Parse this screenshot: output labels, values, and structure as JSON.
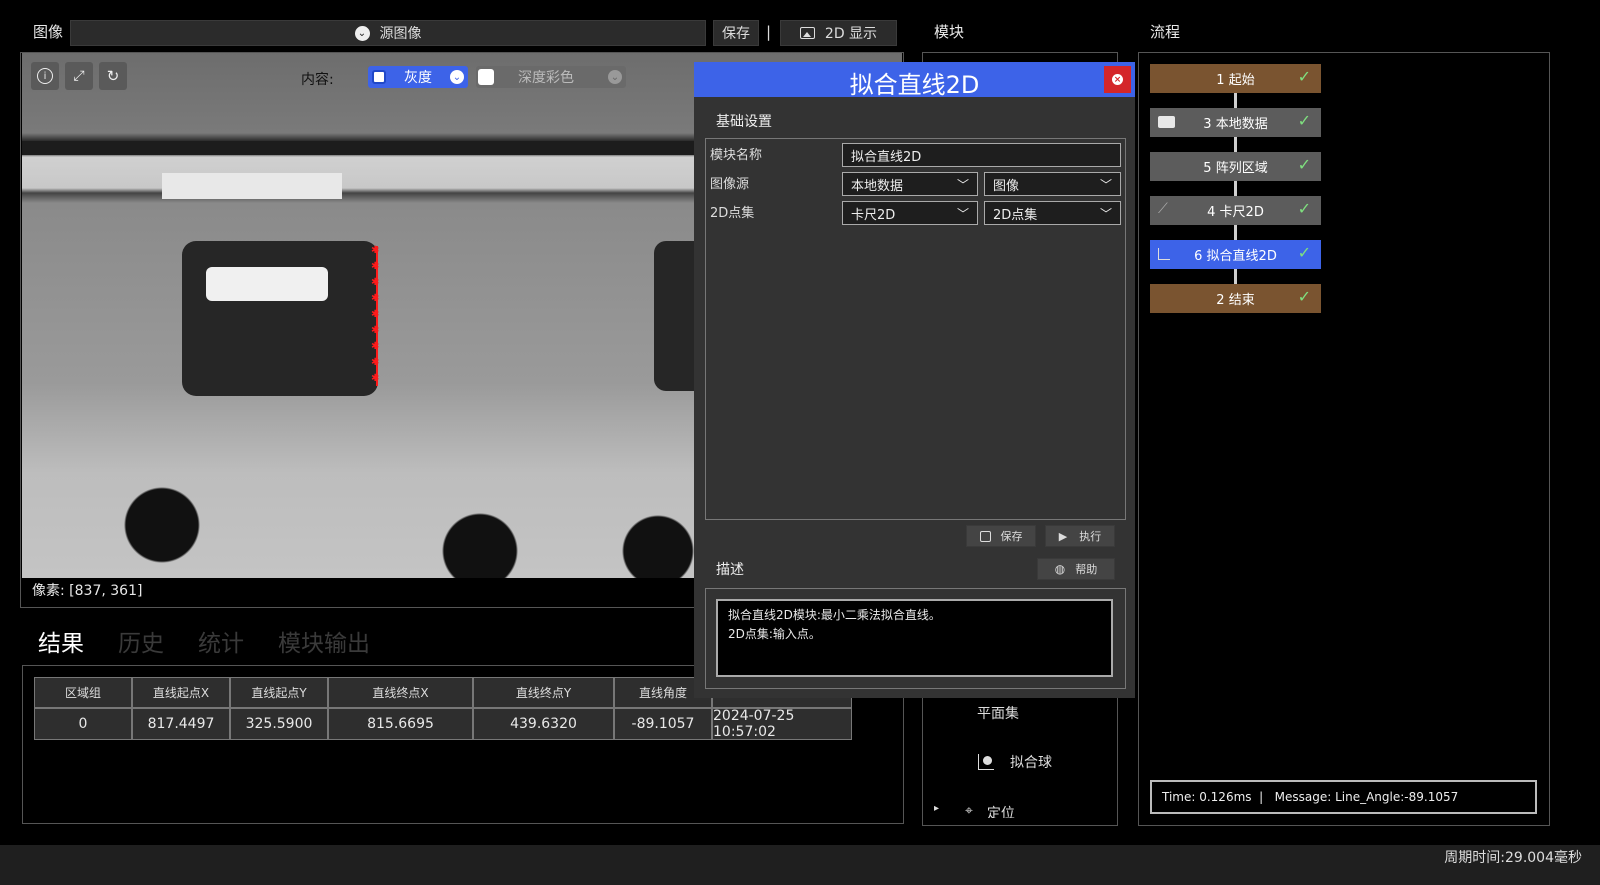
{
  "image_panel": {
    "title": "图像",
    "source_label": "源图像",
    "save_label": "保存",
    "separator": "|",
    "display_label": "2D 显示",
    "content_label": "内容:",
    "gray_label": "灰度",
    "depth_label": "深度彩色",
    "pixel_readout": "像素: [837, 361]"
  },
  "results": {
    "tabs": [
      "结果",
      "历史",
      "统计",
      "模块输出"
    ],
    "headers": [
      "区域组",
      "直线起点X",
      "直线起点Y",
      "直线终点X",
      "直线终点Y",
      "直线角度",
      ""
    ],
    "rows": [
      [
        "0",
        "817.4497",
        "325.5900",
        "815.6695",
        "439.6320",
        "-89.1057",
        "2024-07-25 10:57:02"
      ]
    ]
  },
  "module_panel": {
    "title": "模块",
    "items": [
      "平面集",
      "拟合球",
      "定位"
    ]
  },
  "dialog": {
    "title": "拟合直线2D",
    "section_basic": "基础设置",
    "module_name_label": "模块名称",
    "module_name_value": "拟合直线2D",
    "image_source_label": "图像源",
    "image_source_value1": "本地数据",
    "image_source_value2": "图像",
    "pointset_label": "2D点集",
    "pointset_value1": "卡尺2D",
    "pointset_value2": "2D点集",
    "save_label": "保存",
    "run_label": "执行",
    "desc_title": "描述",
    "help_label": "帮助",
    "desc_line1": "拟合直线2D模块:最小二乘法拟合直线。",
    "desc_line2": "2D点集:输入点。"
  },
  "flow": {
    "title": "流程",
    "nodes": [
      {
        "label": "1 起始",
        "icon": "",
        "color": "#7a5430"
      },
      {
        "label": "3 本地数据",
        "icon": "folder-icon",
        "color": "#5c5c5c"
      },
      {
        "label": "5 阵列区域",
        "icon": "",
        "color": "#5c5c5c"
      },
      {
        "label": "4 卡尺2D",
        "icon": "caliper-icon",
        "color": "#5c5c5c"
      },
      {
        "label": "6 拟合直线2D",
        "icon": "line-fit-icon",
        "color": "#3d63e8"
      },
      {
        "label": "2 结束",
        "icon": "",
        "color": "#7a5430"
      }
    ],
    "status": "Time: 0.126ms  |   Message: Line_Angle:-89.1057"
  },
  "footer": {
    "cycle_time": "周期时间:29.004毫秒"
  },
  "colors": {
    "dialog_header": "#3d63e8",
    "close_button": "#d4262a",
    "check": "#7fe07f"
  }
}
